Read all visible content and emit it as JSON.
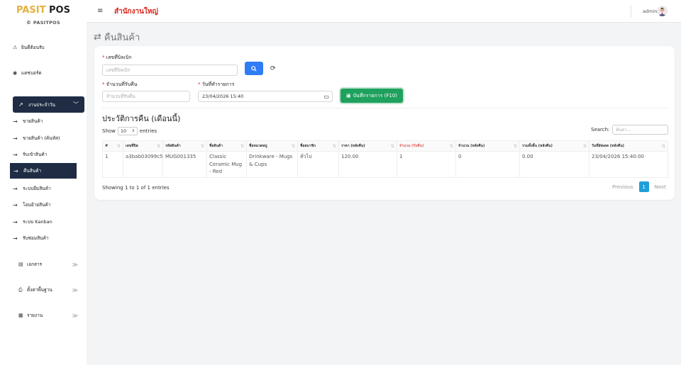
{
  "brand": {
    "part1": "PASIT",
    "part2": " POS",
    "sub": "PASITPOS"
  },
  "sidebar": {
    "items": [
      {
        "label": "ยินดีต้อนรับ",
        "icon": "warning-icon"
      },
      {
        "label": "แดชบอร์ด",
        "icon": "dashboard-icon"
      }
    ],
    "group": {
      "label": "งานประจำวัน",
      "icon": "trend-icon"
    },
    "sub_items": [
      {
        "label": "ขายสินค้า"
      },
      {
        "label": "ขายสินค้า (ค้นหัส)"
      },
      {
        "label": "รับเข้าสินค้า"
      },
      {
        "label": "คืนสินค้า"
      },
      {
        "label": "ระบบยืมสินค้า"
      },
      {
        "label": "โอนย้ายสินค้า"
      },
      {
        "label": "ระบบ Kanban"
      },
      {
        "label": "รับซ่อมสินค้า"
      }
    ],
    "bottom_items": [
      {
        "label": "เอกสาร",
        "icon": "document-icon"
      },
      {
        "label": "ตั้งค่าพื้นฐาน",
        "icon": "printer-icon"
      },
      {
        "label": "รายงาน",
        "icon": "report-icon"
      }
    ]
  },
  "topbar": {
    "branch": "สำนักงานใหญ่",
    "user": "admin"
  },
  "page": {
    "title": "คืนสินค้า"
  },
  "form": {
    "bill_label": "เลขที่บิลเบิก",
    "bill_placeholder": "เลขที่บิลเบิก",
    "qty_label": "จำนวนที่รับคืน",
    "qty_placeholder": "จำนวนที่รับคืน",
    "date_label": "วันที่ทำรายการ",
    "date_value": "23/04/2026 15:40",
    "save_label": "บันทึกรายการ (F10)"
  },
  "history": {
    "title": "ประวัติการคืน (เดือนนี้)",
    "show_label": "Show",
    "show_value": "10",
    "entries_label": "entries",
    "search_label": "Search:",
    "search_placeholder": "ค้นหา...",
    "columns": [
      "#",
      "เลขที่บิล",
      "รหัสสินค้า",
      "ชื่อสินค้า",
      "ชื่อหมวดหมู่",
      "ชื่อสมาชิก",
      "ราคา (หลังคืน)",
      "จำนวน (รับคืน)",
      "จำนวน (หลังคืน)",
      "รวมทั้งสิ้น (หลังคืน)",
      "วันที่อัพเดต (หลังคืน)"
    ],
    "rows": [
      [
        "1",
        "a3bab03099c5",
        "MUG001335",
        "Classic Ceramic Mug - Red",
        "Drinkware - Mugs & Cups",
        "ทั่วไป",
        "120.00",
        "1",
        "0",
        "0.00",
        "23/04/2026 15:40:00"
      ]
    ],
    "info": "Showing 1 to 1 of 1 entries",
    "pager": {
      "prev": "Previous",
      "current": "1",
      "next": "Next"
    }
  },
  "colors": {
    "brand_gold": "#e2b13c",
    "sidebar_active": "#1f2c44",
    "primary": "#2f7cf6",
    "success": "#1fa15e",
    "danger": "#d9261c",
    "pager": "#1e9fd8"
  }
}
